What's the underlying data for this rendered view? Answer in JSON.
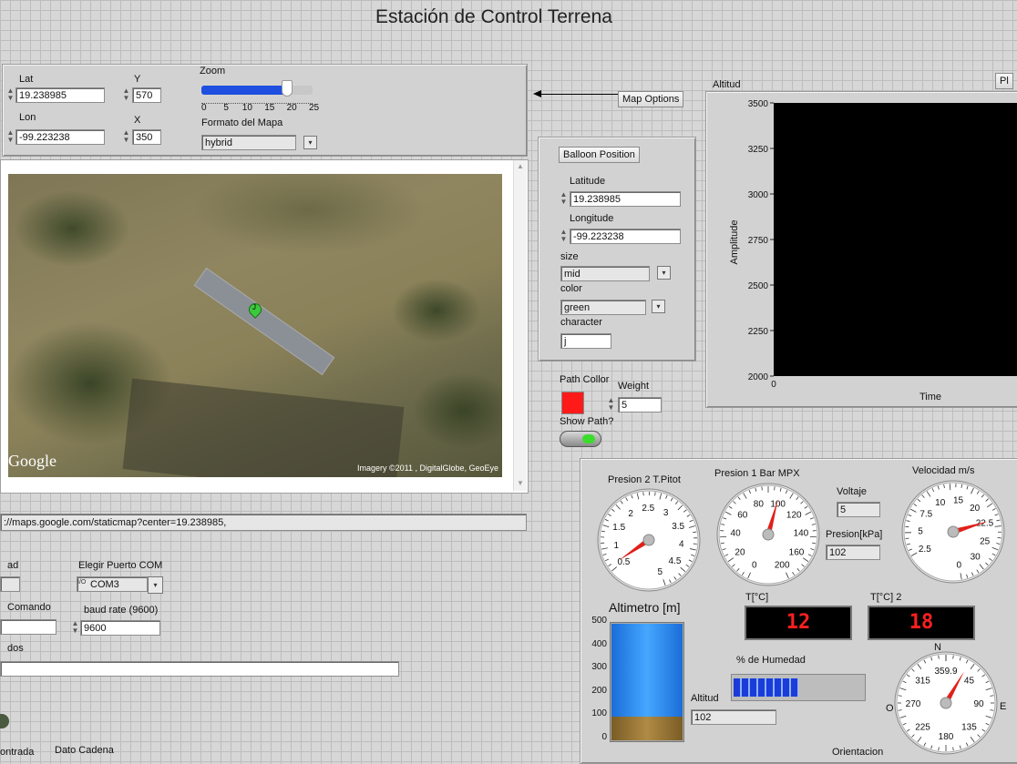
{
  "page_title": "Estación de Control Terrena",
  "map_options_panel": {
    "lat_label": "Lat",
    "lat_value": "19.238985",
    "y_label": "Y",
    "y_value": "570",
    "lon_label": "Lon",
    "lon_value": "-99.223238",
    "x_label": "X",
    "x_value": "350",
    "zoom_label": "Zoom",
    "zoom_ticks": [
      "0",
      "5",
      "10",
      "15",
      "20",
      "25"
    ],
    "zoom_value": 19,
    "format_label": "Formato del Mapa",
    "format_value": "hybrid"
  },
  "map_options_button": "Map Options",
  "map_view": {
    "google_logo": "Google",
    "imagery_credit": "Imagery ©2011 , DigitalGlobe, GeoEye",
    "marker_letter": "J"
  },
  "url_field": "://maps.google.com/staticmap?center=19.238985,",
  "balloon_panel": {
    "button": "Balloon Position",
    "latitude_label": "Latitude",
    "latitude_value": "19.238985",
    "longitude_label": "Longitude",
    "longitude_value": "-99.223238",
    "size_label": "size",
    "size_value": "mid",
    "color_label": "color",
    "color_value": "green",
    "character_label": "character",
    "character_value": "j"
  },
  "path": {
    "color_label": "Path Collor",
    "color": "#ff1a1a",
    "weight_label": "Weight",
    "weight_value": "5",
    "show_label": "Show Path?"
  },
  "altitude_chart_title": "Altitud",
  "plot_button": "Pl",
  "com_panel": {
    "left_label_1": "ad",
    "port_label": "Elegir Puerto COM",
    "port_value": "COM3",
    "port_icon": "I/O",
    "command_label": "Comando",
    "baud_label": "baud rate (9600)",
    "baud_value": "9600",
    "data_label": "dos",
    "tab_input": "ontrada",
    "tab_string": "Dato Cadena"
  },
  "sensors": {
    "pitot_label": "Presion 2 T.Pitot",
    "bar_label": "Presion 1 Bar MPX",
    "voltage_label": "Voltaje",
    "voltage_value": "5",
    "pressure_label": "Presion[kPa]",
    "pressure_value": "102",
    "speed_label": "Velocidad m/s",
    "altimeter_label": "Altimetro [m]",
    "altimeter_ticks": [
      "500",
      "400",
      "300",
      "200",
      "100",
      "0"
    ],
    "altimeter_value": 102,
    "altitude_label": "Altitud",
    "altitude_value": "102",
    "temp1_label": "T[°C]",
    "temp1_value": "12",
    "temp2_label": "T[°C] 2",
    "temp2_value": "18",
    "humidity_label": "% de Humedad",
    "humidity_fraction": 0.5,
    "north": "N",
    "west": "O",
    "east": "E",
    "orientation_label": "Orientacion"
  },
  "gauges": {
    "pitot": {
      "labels": [
        "0.5",
        "1",
        "1.5",
        "2",
        "2.5",
        "3",
        "3.5",
        "4",
        "4.5",
        "5"
      ],
      "value": 0.1
    },
    "bar": {
      "labels": [
        "0",
        "20",
        "40",
        "60",
        "80",
        "100",
        "120",
        "140",
        "160",
        "200"
      ],
      "value": 110
    },
    "speed": {
      "labels": [
        "2.5",
        "5",
        "7.5",
        "10",
        "15",
        "20",
        "22.5",
        "25",
        "30",
        "0"
      ],
      "value": 20
    },
    "compass": {
      "labels": [
        "359.9",
        "45",
        "90",
        "135",
        "180",
        "225",
        "270",
        "315"
      ],
      "value": 30
    }
  },
  "chart_data": {
    "type": "line",
    "title": "Altitud",
    "xlabel": "Time",
    "ylabel": "Amplitude",
    "x_ticks": [
      "0"
    ],
    "y_ticks": [
      "3500",
      "3250",
      "3000",
      "2750",
      "2500",
      "2250",
      "2000"
    ],
    "ylim": [
      2000,
      3500
    ],
    "series": []
  }
}
